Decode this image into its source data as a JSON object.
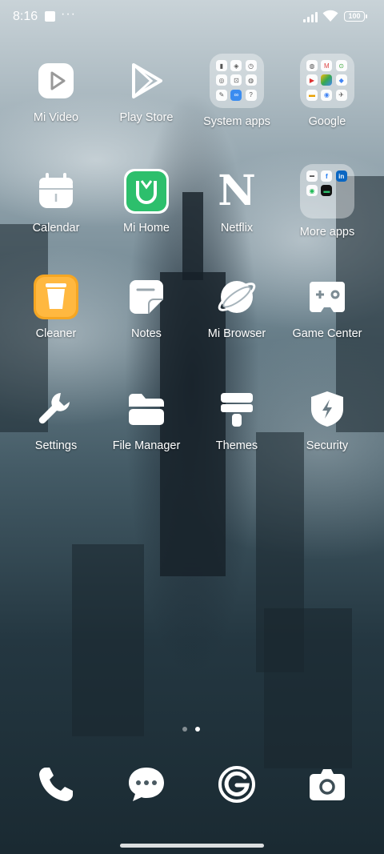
{
  "status_bar": {
    "time": "8:16",
    "dots": "···",
    "battery": "100"
  },
  "apps": {
    "mi_video": {
      "label": "Mi Video"
    },
    "play_store": {
      "label": "Play Store"
    },
    "system_apps": {
      "label": "System apps"
    },
    "google": {
      "label": "Google"
    },
    "calendar": {
      "label": "Calendar"
    },
    "mi_home": {
      "label": "Mi Home"
    },
    "netflix": {
      "label": "Netflix",
      "glyph": "N"
    },
    "more_apps": {
      "label": "More apps",
      "glyph_li": "in",
      "glyph_fb": "f"
    },
    "cleaner": {
      "label": "Cleaner"
    },
    "notes": {
      "label": "Notes"
    },
    "mi_browser": {
      "label": "Mi Browser"
    },
    "game_center": {
      "label": "Game Center"
    },
    "settings": {
      "label": "Settings"
    },
    "file_manager": {
      "label": "File Manager"
    },
    "themes": {
      "label": "Themes"
    },
    "security": {
      "label": "Security"
    }
  },
  "dock": {
    "phone": {
      "icon": "phone-icon"
    },
    "messages": {
      "icon": "chat-bubble-icon"
    },
    "browser": {
      "icon": "g-browser-icon"
    },
    "camera": {
      "icon": "camera-icon"
    }
  },
  "pager": {
    "pages": 2,
    "active": 1
  },
  "colors": {
    "mi_home": "#2dbf6c",
    "cleaner": "#f5a623",
    "accent_white": "#ffffff"
  }
}
